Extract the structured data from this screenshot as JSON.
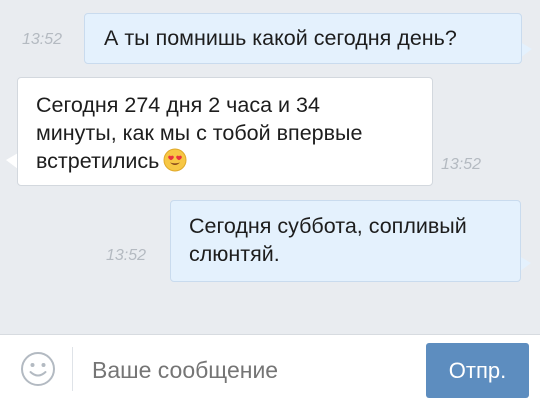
{
  "messages": [
    {
      "direction": "outgoing",
      "text": "А ты помнишь какой сегодня день?",
      "time": "13:52"
    },
    {
      "direction": "incoming",
      "text_line1": "Сегодня 274 дня 2 часа и 34",
      "text_line2": "минуты, как мы с тобой впервые",
      "text_line3": "встретились",
      "emoji": "smiling-face-with-heart-eyes",
      "time": "13:52"
    },
    {
      "direction": "outgoing",
      "text_line1": "Сегодня суббота, сопливый",
      "text_line2": "слюнтяй.",
      "time": "13:52"
    }
  ],
  "composer": {
    "placeholder": "Ваше сообщение",
    "send_label": "Отпр.",
    "emoji_button_icon": "smiley-icon"
  },
  "colors": {
    "background": "#e9ecf0",
    "outgoing_bubble": "#e4f1fd",
    "incoming_bubble": "#ffffff",
    "send_button": "#5d8dbf",
    "time_text": "#b4bac1"
  }
}
